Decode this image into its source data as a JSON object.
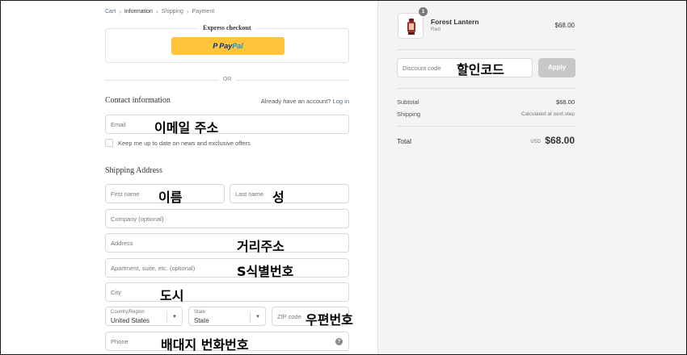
{
  "breadcrumb": {
    "items": [
      {
        "label": "Cart",
        "state": "link"
      },
      {
        "label": "Information",
        "state": "current"
      },
      {
        "label": "Shipping",
        "state": "upcoming"
      },
      {
        "label": "Payment",
        "state": "upcoming"
      }
    ],
    "separator": "›"
  },
  "express": {
    "title": "Express checkout",
    "paypal_a": "Pay",
    "paypal_b": "Pal",
    "paypal_icon": "P"
  },
  "divider_text": "OR",
  "contact": {
    "title": "Contact information",
    "login_prompt": "Already have an account?",
    "login_link": "Log in",
    "email_placeholder": "Email",
    "email_value": "이메일 주소",
    "newsletter_label": "Keep me up to date on news and exclusive offers"
  },
  "shipping": {
    "title": "Shipping Address",
    "first_name_placeholder": "First name",
    "first_name_value": "이름",
    "last_name_placeholder": "Last name",
    "last_name_value": "성",
    "company_placeholder": "Company (optional)",
    "address_placeholder": "Address",
    "address_value": "거리주소",
    "apartment_placeholder": "Apartment, suite, etc. (optional)",
    "apartment_value": "S식별번호",
    "city_placeholder": "City",
    "city_value": "도시",
    "country_label": "Country/Region",
    "country_value": "United States",
    "state_label": "State",
    "state_value": "State",
    "zip_placeholder": "ZIP code",
    "zip_value": "우편번호",
    "phone_placeholder": "Phone",
    "phone_value": "배대지 번화번호",
    "help_icon": "?"
  },
  "summary": {
    "product": {
      "name": "Forest Lantern",
      "variant": "Red",
      "price": "$68.00",
      "quantity": "1"
    },
    "discount_placeholder": "Discount code",
    "discount_value": "할인코드",
    "apply_label": "Apply",
    "subtotal_label": "Subtotal",
    "subtotal_value": "$68.00",
    "shipping_label": "Shipping",
    "shipping_value": "Calculated at next step",
    "total_label": "Total",
    "total_currency": "USD",
    "total_value": "$68.00"
  }
}
